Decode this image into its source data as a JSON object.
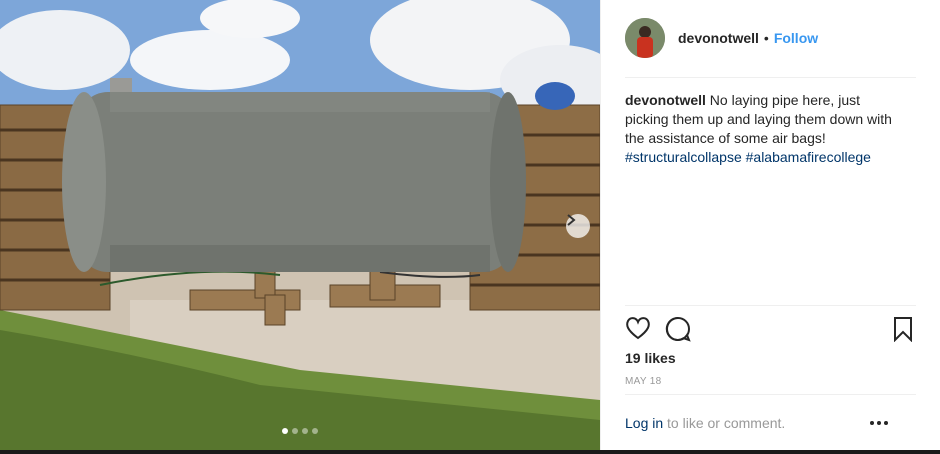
{
  "post": {
    "username": "devonotwell",
    "separator": "•",
    "follow_label": "Follow",
    "caption_text": "No laying pipe here, just picking them up and laying them down with the assistance of some air bags!",
    "hashtags": [
      "#structuralcollapse",
      "#alabamafirecollege"
    ],
    "likes_text": "19 likes",
    "date_text": "MAY 18",
    "login_link": "Log in",
    "login_rest": " to like or comment.",
    "carousel": {
      "slide_count": 4,
      "active_index": 0
    }
  },
  "icons": {
    "like": "heart-icon",
    "comment": "comment-icon",
    "save": "bookmark-icon",
    "more": "more-options-icon",
    "next": "chevron-right-icon"
  },
  "colors": {
    "link_blue": "#3897f0",
    "hashtag_blue": "#003569",
    "muted_gray": "#999999"
  }
}
